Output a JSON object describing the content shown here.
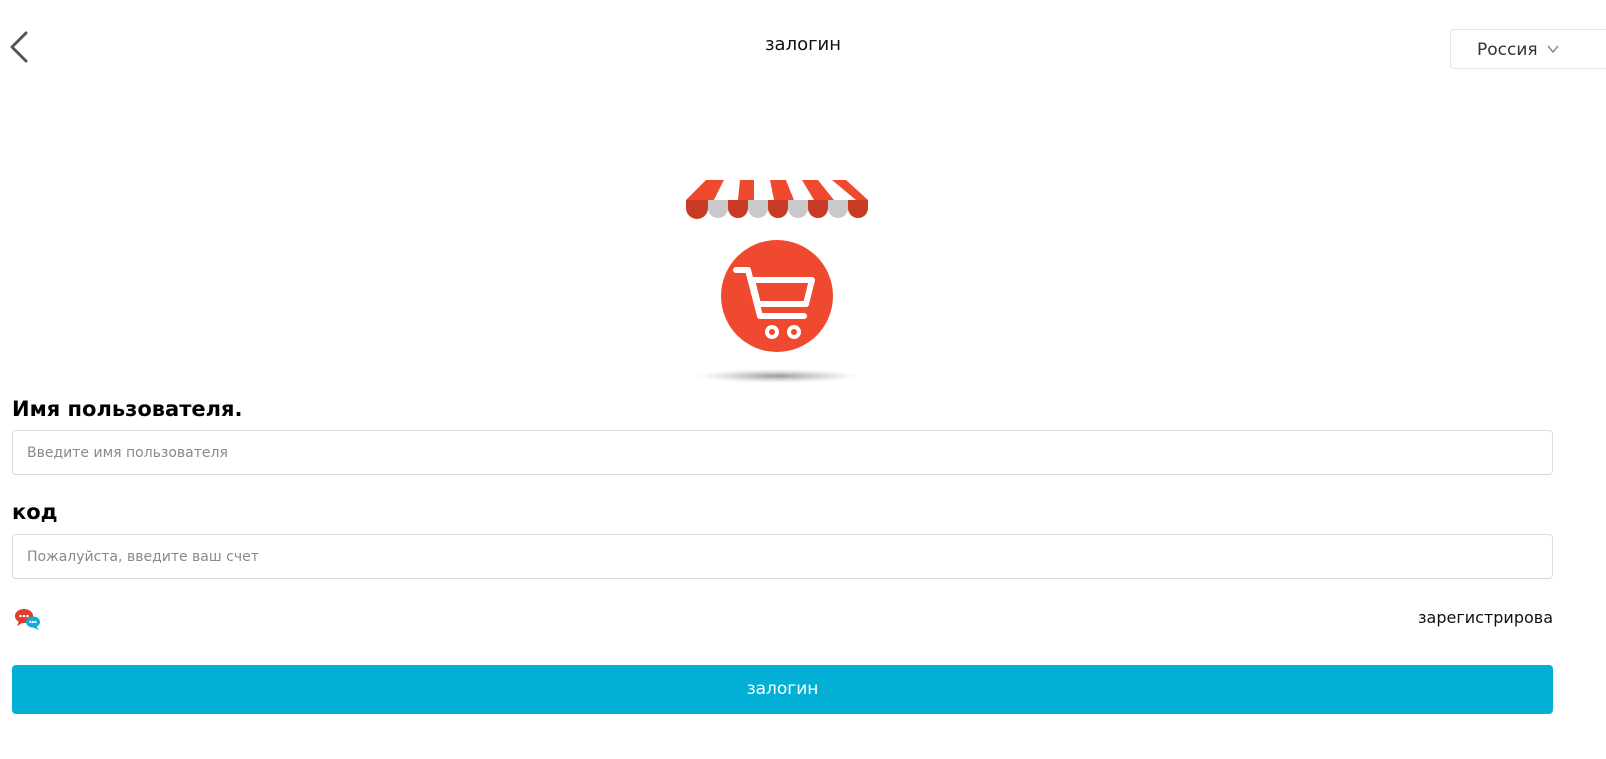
{
  "header": {
    "title": "залогин",
    "back_icon": "chevron-left-icon",
    "language": {
      "selected": "Россия",
      "icon": "chevron-down-icon"
    }
  },
  "logo": {
    "icon": "shop-cart-awning-logo",
    "colors": {
      "red": "#ef4a2f",
      "dark_red": "#c73a24",
      "gray": "#c9c9cc",
      "shadow": "#9a9a9a"
    }
  },
  "form": {
    "username": {
      "label": "Имя пользователя.",
      "placeholder": "Введите имя пользователя",
      "value": ""
    },
    "code": {
      "label": "код",
      "placeholder": "Пожалуйста, введите ваш счет",
      "value": ""
    }
  },
  "support": {
    "icon": "chat-bubbles-icon"
  },
  "register_label": "зарегистрирова",
  "login_button": "залогин",
  "colors": {
    "accent": "#02b0d6"
  }
}
